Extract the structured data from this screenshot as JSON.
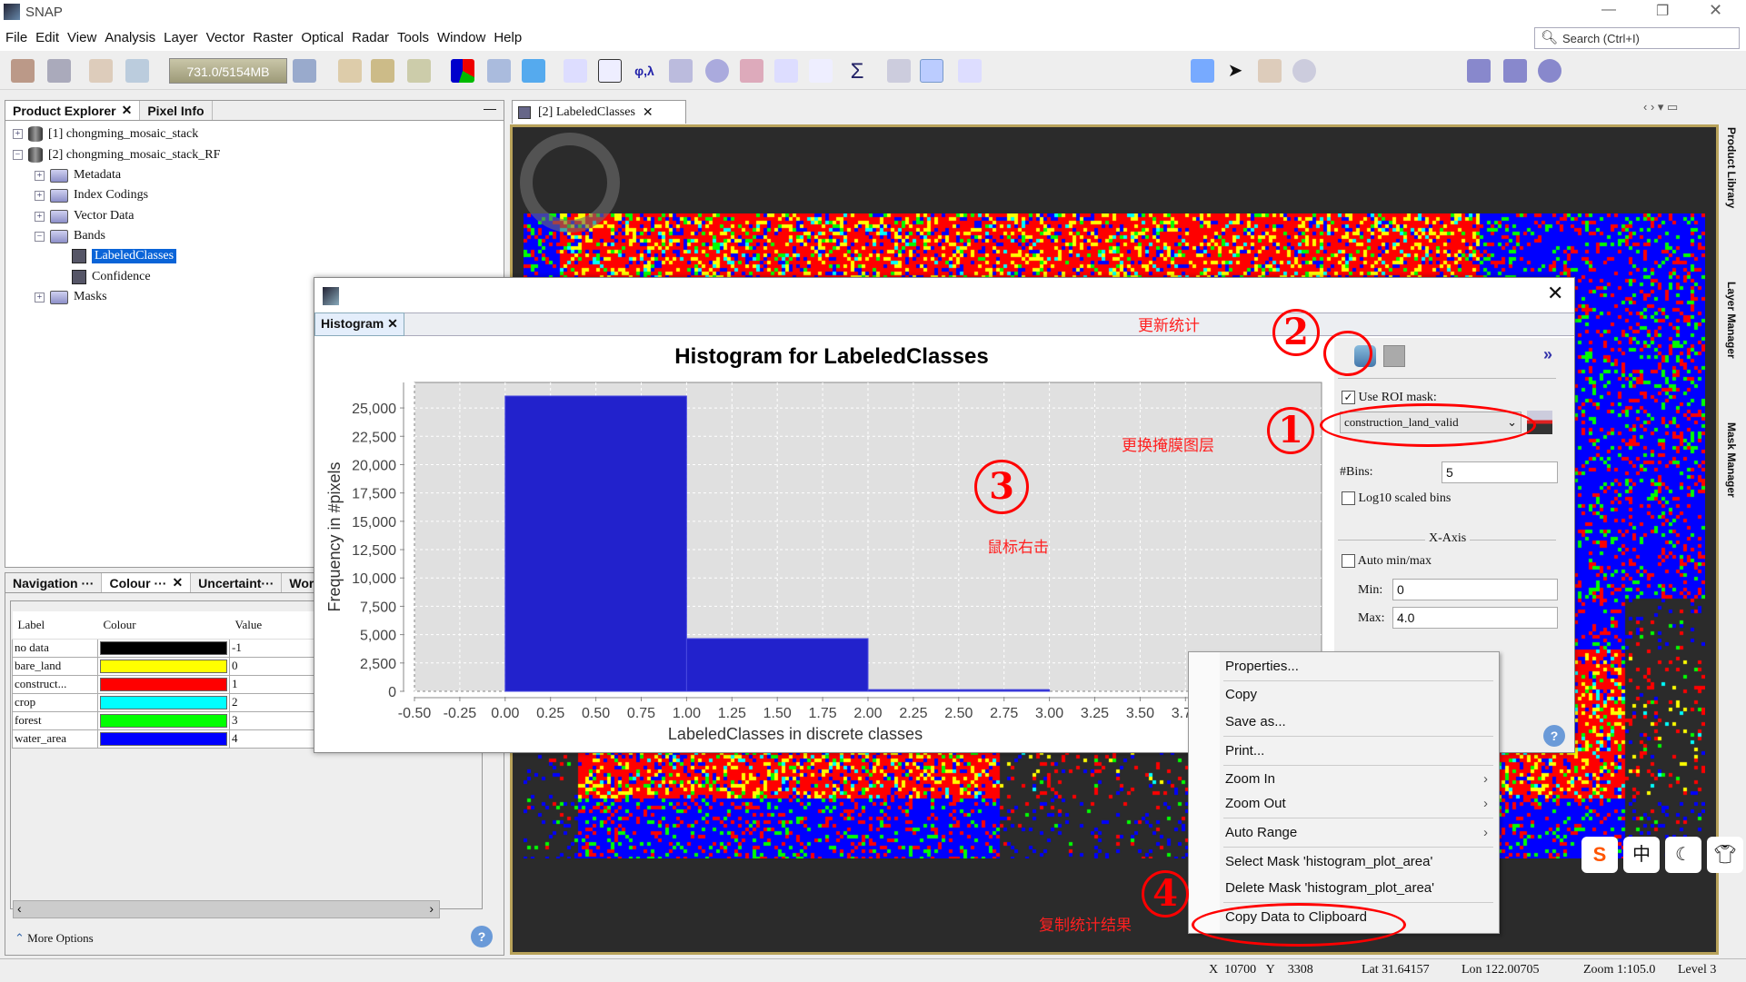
{
  "app": {
    "title": "SNAP"
  },
  "menu": [
    "File",
    "Edit",
    "View",
    "Analysis",
    "Layer",
    "Vector",
    "Raster",
    "Optical",
    "Radar",
    "Tools",
    "Window",
    "Help"
  ],
  "search": {
    "placeholder": "Search (Ctrl+I)"
  },
  "toolbar": {
    "memory": "731.0/5154MB"
  },
  "product_explorer": {
    "tabs": [
      "Product Explorer",
      "Pixel Info"
    ],
    "tree": [
      {
        "label": "[1] chongming_mosaic_stack",
        "icon": "database-icon",
        "expander": "+"
      },
      {
        "label": "[2] chongming_mosaic_stack_RF",
        "icon": "database-icon",
        "expander": "−"
      },
      {
        "label": "Metadata",
        "icon": "folder-icon",
        "expander": "+"
      },
      {
        "label": "Index Codings",
        "icon": "folder-icon",
        "expander": "+"
      },
      {
        "label": "Vector Data",
        "icon": "folder-icon",
        "expander": "+"
      },
      {
        "label": "Bands",
        "icon": "folder-open-icon",
        "expander": "−"
      },
      {
        "label": "LabeledClasses",
        "icon": "band-icon",
        "selected": true
      },
      {
        "label": "Confidence",
        "icon": "band-icon"
      },
      {
        "label": "Masks",
        "icon": "folder-icon",
        "expander": "+"
      }
    ]
  },
  "colour_panel": {
    "tabs": [
      "Navigation ···",
      "Colour ···",
      "Uncertaint···",
      "Worl"
    ],
    "headers": [
      "Label",
      "Colour",
      "Value"
    ],
    "rows": [
      {
        "label": "no data",
        "color": "#000000",
        "value": "-1"
      },
      {
        "label": "bare_land",
        "color": "#ffff00",
        "value": "0"
      },
      {
        "label": "construct...",
        "color": "#ff0000",
        "value": "1"
      },
      {
        "label": "crop",
        "color": "#00ffff",
        "value": "2"
      },
      {
        "label": "forest",
        "color": "#00ff00",
        "value": "3"
      },
      {
        "label": "water_area",
        "color": "#0000ff",
        "value": "4"
      }
    ],
    "more_options": "More Options"
  },
  "image_view": {
    "tab": "[2] LabeledClasses"
  },
  "side_tabs": [
    "Product Library",
    "Layer Manager",
    "Mask Manager"
  ],
  "histogram": {
    "tab": "Histogram",
    "use_roi_label": "Use ROI mask:",
    "use_roi": true,
    "roi_mask": "construction_land_valid",
    "bins_label": "#Bins:",
    "bins": "5",
    "log10_label": "Log10 scaled bins",
    "log10": false,
    "xaxis_label": "X-Axis",
    "auto_label": "Auto min/max",
    "auto": false,
    "min_label": "Min:",
    "min": "0",
    "max_label": "Max:",
    "max": "4.0",
    "expand": "»"
  },
  "chart_data": {
    "type": "bar",
    "title": "Histogram for LabeledClasses",
    "xlabel": "LabeledClasses in discrete classes",
    "ylabel": "Frequency in #pixels",
    "bins": [
      {
        "x0": 0,
        "x1": 1,
        "value": 26050
      },
      {
        "x0": 1,
        "x1": 2,
        "value": 4650
      },
      {
        "x0": 2,
        "x1": 3,
        "value": 150
      }
    ],
    "xlim": [
      -0.5,
      4.5
    ],
    "ylim": [
      0,
      27250
    ],
    "x_ticks": [
      "-0.50",
      "-0.25",
      "0.00",
      "0.25",
      "0.50",
      "0.75",
      "1.00",
      "1.25",
      "1.50",
      "1.75",
      "2.00",
      "2.25",
      "2.50",
      "2.75",
      "3.00",
      "3.25",
      "3.50",
      "3.75"
    ],
    "y_ticks": [
      "0",
      "2,500",
      "5,000",
      "7,500",
      "10,000",
      "12,500",
      "15,000",
      "17,500",
      "20,000",
      "22,500",
      "25,000"
    ],
    "grid": true,
    "bar_color": "#2222cc",
    "plot_bg": "#e0e0e0"
  },
  "context_menu": [
    {
      "label": "Properties..."
    },
    {
      "label": "Copy"
    },
    {
      "label": "Save as..."
    },
    {
      "label": "Print..."
    },
    {
      "label": "Zoom In",
      "sub": "›"
    },
    {
      "label": "Zoom Out",
      "sub": "›"
    },
    {
      "label": "Auto Range",
      "sub": "›"
    },
    {
      "label": "Select Mask 'histogram_plot_area'"
    },
    {
      "label": "Delete Mask 'histogram_plot_area'"
    },
    {
      "label": "Copy Data to Clipboard"
    }
  ],
  "annotations": {
    "n1": "1",
    "n2": "2",
    "n3": "3",
    "n4": "4",
    "a1": "更换掩膜图层",
    "a2": "更新统计",
    "a3": "鼠标右击",
    "a4": "复制统计结果"
  },
  "status": {
    "x_label": "X",
    "x": "10700",
    "y_label": "Y",
    "y": "3308",
    "lat": "Lat 31.64157",
    "lon": "Lon 122.00705",
    "zoom": "Zoom 1:105.0",
    "level": "Level 3"
  }
}
